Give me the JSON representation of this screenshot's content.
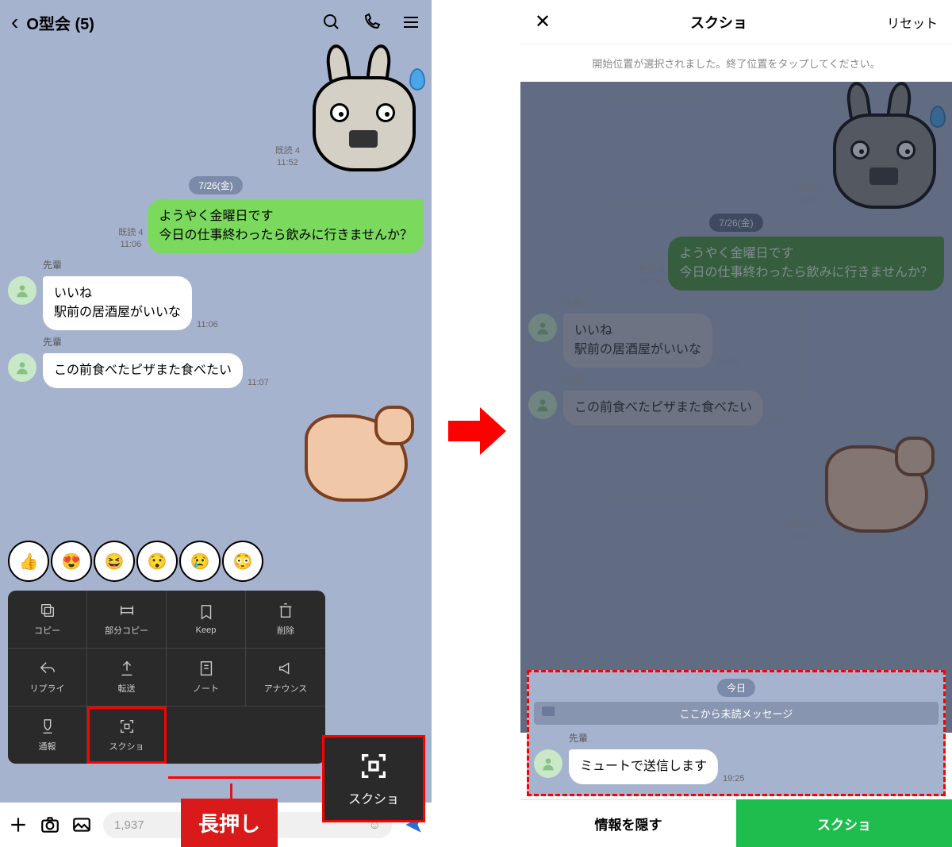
{
  "left": {
    "chat_title": "O型会 (5)",
    "date_pill": "7/26(金)",
    "sticker_meta_read": "既読 4",
    "sticker_meta_time": "11:52",
    "out1_text": "ようやく金曜日です\n今日の仕事終わったら飲みに行きませんか？",
    "out1_read": "既読 4",
    "out1_time": "11:06",
    "sender1": "先輩",
    "in1_text": "いいね\n駅前の居酒屋がいいな",
    "in1_time": "11:06",
    "sender2": "先輩",
    "in2_text": "この前食べたピザまた食べたい",
    "in2_time": "11:07",
    "mute_sender": "先輩",
    "mute_text": "ミュートで送信します",
    "mute_time": "19:25",
    "context": {
      "copy": "コピー",
      "partial_copy": "部分コピー",
      "keep": "Keep",
      "delete": "削除",
      "reply": "リプライ",
      "forward": "転送",
      "note": "ノート",
      "announce": "アナウンス",
      "report": "通報",
      "screenshot": "スクショ"
    },
    "screenshot_label": "スクショ",
    "longpress_label": "長押し",
    "input_placeholder": "1,937"
  },
  "right": {
    "title": "スクショ",
    "reset": "リセット",
    "instruction": "開始位置が選択されました。終了位置をタップしてください。",
    "date_pill": "7/26(金)",
    "sticker_meta_read": "既読 4",
    "sticker_meta_time": "11:52",
    "out1_text": "ようやく金曜日です\n今日の仕事終わったら飲みに行きませんか？",
    "out1_read": "既読 4",
    "out1_time": "11:06",
    "sender1": "先輩",
    "in1_text": "いいね\n駅前の居酒屋がいいな",
    "in1_time": "11:06",
    "sender2": "先輩",
    "in2_text": "この前食べたピザまた食べたい",
    "in2_time": "11:07",
    "arm_read": "既読 4",
    "arm_time": "11:07",
    "today_label": "今日",
    "unread_label": "ここから未読メッセージ",
    "sel_sender": "先輩",
    "sel_text": "ミュートで送信します",
    "sel_time": "19:25",
    "btn_hide": "情報を隠す",
    "btn_shot": "スクショ"
  }
}
